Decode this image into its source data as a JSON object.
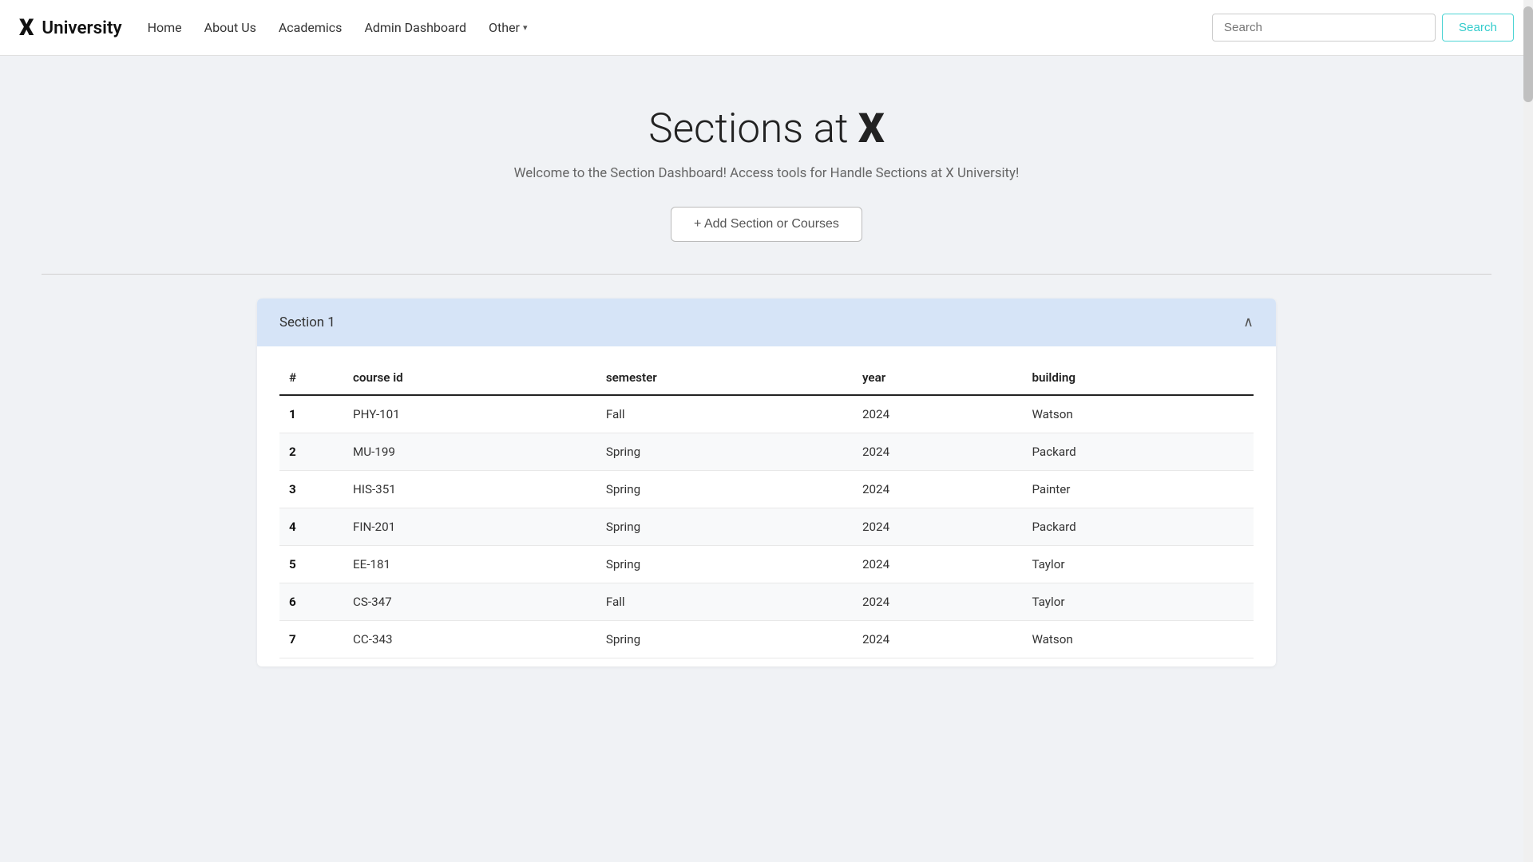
{
  "brand": {
    "x_symbol": "X",
    "name": "University"
  },
  "navbar": {
    "links": [
      {
        "label": "Home",
        "id": "home"
      },
      {
        "label": "About Us",
        "id": "about"
      },
      {
        "label": "Academics",
        "id": "academics"
      },
      {
        "label": "Admin Dashboard",
        "id": "admin"
      }
    ],
    "other_label": "Other",
    "search_placeholder": "Search",
    "search_btn_label": "Search"
  },
  "hero": {
    "title_prefix": "Sections at ",
    "title_x": "X",
    "subtitle": "Welcome to the Section Dashboard! Access tools for Handle Sections at X University!",
    "add_btn_label": "+ Add Section or Courses"
  },
  "section": {
    "title": "Section 1",
    "columns": [
      "#",
      "course id",
      "semester",
      "year",
      "building"
    ],
    "rows": [
      {
        "num": "1",
        "course_id": "PHY-101",
        "semester": "Fall",
        "year": "2024",
        "building": "Watson"
      },
      {
        "num": "2",
        "course_id": "MU-199",
        "semester": "Spring",
        "year": "2024",
        "building": "Packard"
      },
      {
        "num": "3",
        "course_id": "HIS-351",
        "semester": "Spring",
        "year": "2024",
        "building": "Painter"
      },
      {
        "num": "4",
        "course_id": "FIN-201",
        "semester": "Spring",
        "year": "2024",
        "building": "Packard"
      },
      {
        "num": "5",
        "course_id": "EE-181",
        "semester": "Spring",
        "year": "2024",
        "building": "Taylor"
      },
      {
        "num": "6",
        "course_id": "CS-347",
        "semester": "Fall",
        "year": "2024",
        "building": "Taylor"
      },
      {
        "num": "7",
        "course_id": "CC-343",
        "semester": "Spring",
        "year": "2024",
        "building": "Watson"
      }
    ]
  }
}
